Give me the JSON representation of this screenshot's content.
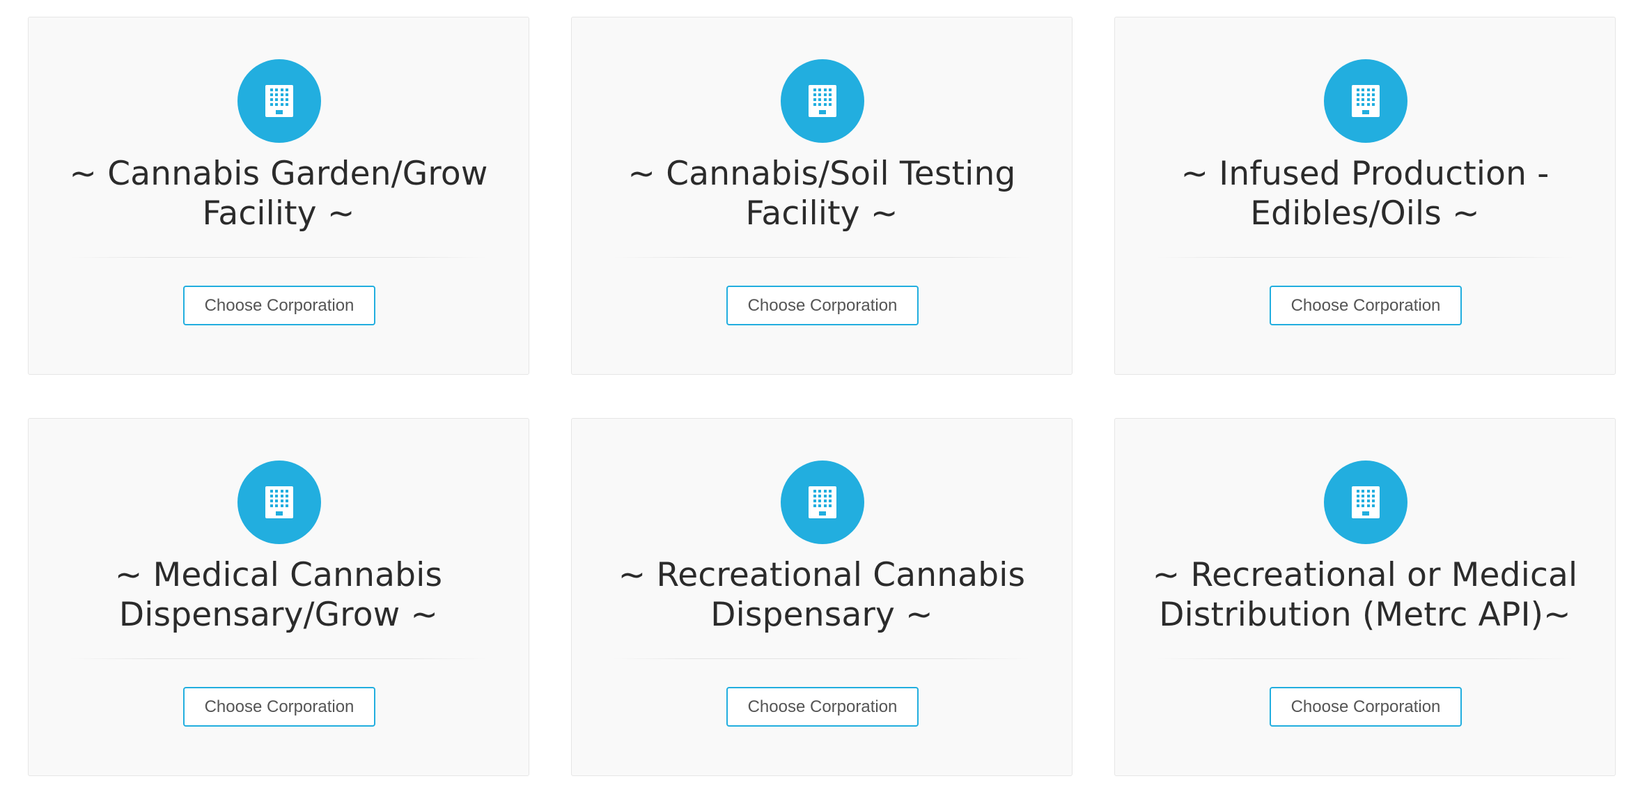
{
  "accent_color": "#22aedf",
  "cards": [
    {
      "title": "~ Cannabis Garden/Grow Facility ~",
      "button_label": "Choose Corporation",
      "icon": "building-icon"
    },
    {
      "title": "~ Cannabis/Soil Testing Facility ~",
      "button_label": "Choose Corporation",
      "icon": "building-icon"
    },
    {
      "title": "~ Infused Production - Edibles/Oils ~",
      "button_label": "Choose Corporation",
      "icon": "building-icon"
    },
    {
      "title": "~ Medical Cannabis Dispensary/Grow ~",
      "button_label": "Choose Corporation",
      "icon": "building-icon"
    },
    {
      "title": "~ Recreational Cannabis Dispensary ~",
      "button_label": "Choose Corporation",
      "icon": "building-icon"
    },
    {
      "title": "~ Recreational or Medical Distribution (Metrc API)~",
      "button_label": "Choose Corporation",
      "icon": "building-icon"
    }
  ]
}
